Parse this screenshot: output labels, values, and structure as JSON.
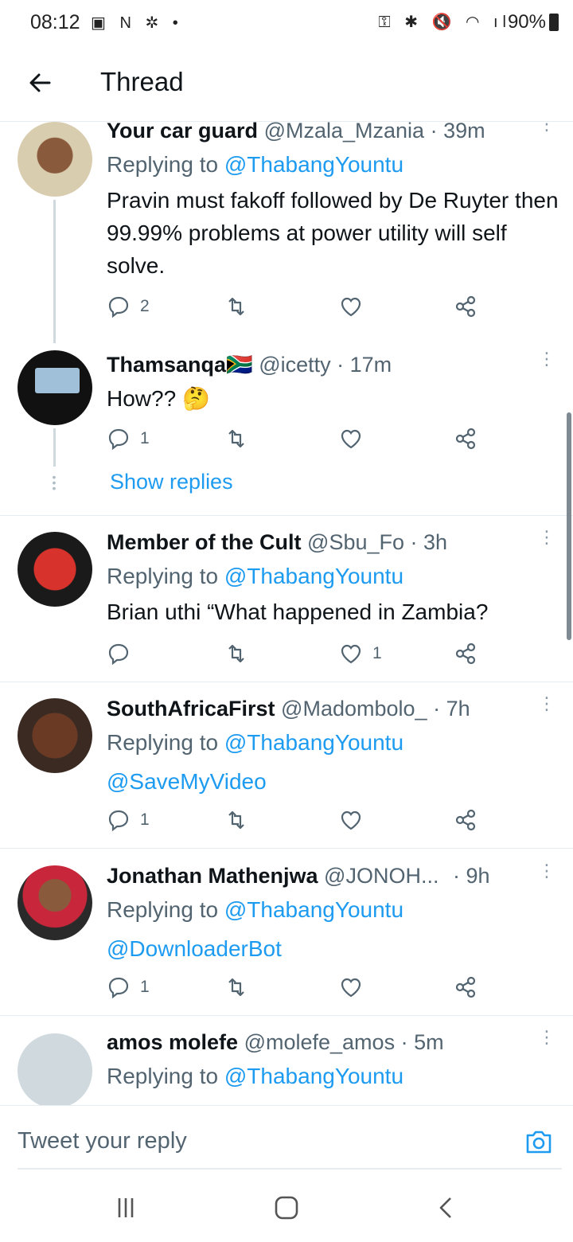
{
  "status_bar": {
    "time": "08:12",
    "battery": "90%"
  },
  "header": {
    "title": "Thread"
  },
  "tweets": [
    {
      "name": "Your car guard",
      "handle": "@Mzala_Mzania",
      "time": "· 39m",
      "reply_prefix": "Replying to ",
      "reply_to": "@ThabangYountu",
      "text": "Pravin must fakoff followed by De Ruyter then 99.99% problems at power utility will self solve.",
      "replies": "2",
      "retweets": "",
      "likes": ""
    },
    {
      "name": "Thamsanqa",
      "flag": "🇿🇦",
      "handle": "@icetty",
      "time": "· 17m",
      "text": "How?? 🤔",
      "replies": "1",
      "retweets": "",
      "likes": ""
    },
    {
      "name": "Member of the Cult",
      "handle": "@Sbu_Fo",
      "time": "· 3h",
      "reply_prefix": "Replying to ",
      "reply_to": "@ThabangYountu",
      "text": "Brian uthi “What happened in Zambia?",
      "replies": "",
      "retweets": "",
      "likes": "1"
    },
    {
      "name": "SouthAfricaFirst",
      "handle": "@Madombolo_",
      "time": "· 7h",
      "reply_prefix": "Replying to ",
      "reply_to": "@ThabangYountu",
      "text": "@SaveMyVideo",
      "replies": "1",
      "retweets": "",
      "likes": ""
    },
    {
      "name": "Jonathan Mathenjwa",
      "handle": "@JONOH...",
      "time": "· 9h",
      "reply_prefix": "Replying to ",
      "reply_to": "@ThabangYountu",
      "text": "@DownloaderBot",
      "replies": "1",
      "retweets": "",
      "likes": ""
    },
    {
      "name": "amos molefe",
      "handle": "@molefe_amos",
      "time": "· 5m",
      "reply_prefix": "Replying to ",
      "reply_to": "@ThabangYountu",
      "text": "",
      "replies": "",
      "retweets": "",
      "likes": ""
    }
  ],
  "show_replies": "Show replies",
  "compose": {
    "placeholder": "Tweet your reply"
  },
  "colors": {
    "link": "#1d9bf0",
    "secondary": "#536471",
    "divider": "#e6ecf0"
  },
  "icons": [
    "back-arrow-icon",
    "reply-icon",
    "retweet-icon",
    "like-icon",
    "share-icon",
    "more-icon",
    "camera-icon",
    "recents-icon",
    "home-icon",
    "back-nav-icon"
  ]
}
